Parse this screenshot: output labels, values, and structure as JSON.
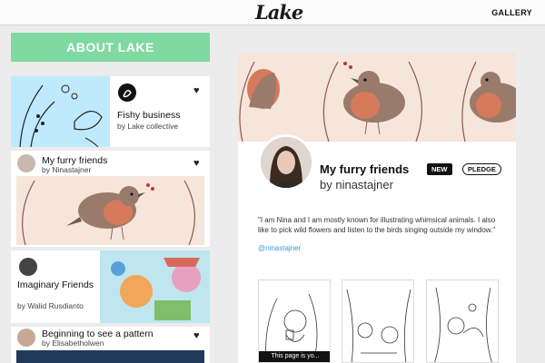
{
  "header": {
    "logo": "Lake",
    "gallery_label": "GALLERY"
  },
  "sidebar": {
    "about_label": "ABOUT LAKE",
    "cards": [
      {
        "title": "Fishy business",
        "byline": "by Lake collective"
      },
      {
        "title": "My furry friends",
        "byline": "by Ninastajner"
      },
      {
        "title": "Imaginary Friends",
        "byline": "by Walid Rusdianto"
      },
      {
        "title": "Beginning to see a pattern",
        "byline": "by Elisabetholwen"
      }
    ]
  },
  "profile": {
    "title": "My furry friends",
    "byline": "by ninastajner",
    "badge_new": "NEW",
    "badge_pledge": "PLEDGE",
    "bio": "\"I am Nina and I am mostly known for illustrating whimsical animals. I also like to pick wild flowers and listen to the birds singing outside my window.\"",
    "handle": "@ninastajner",
    "page_tooltip": "This page is yo..."
  },
  "colors": {
    "accent": "#7fd9a0",
    "link": "#3a9bd8"
  }
}
